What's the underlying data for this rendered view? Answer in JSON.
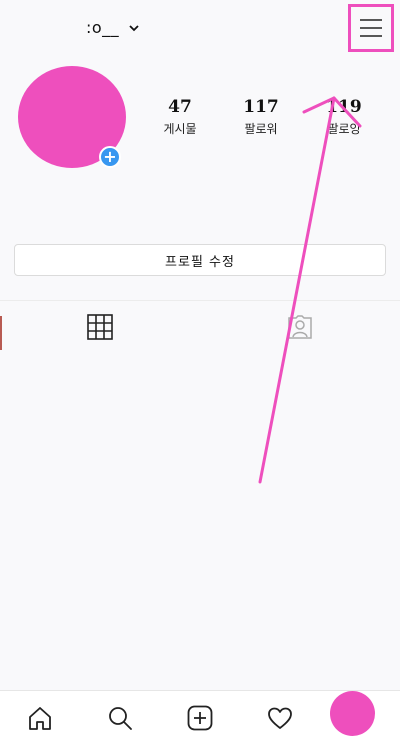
{
  "header": {
    "username": ":o__",
    "username_icon": "chevron-down-icon",
    "menu_icon": "hamburger-menu-icon"
  },
  "profile": {
    "avatar_color": "#ee4fbd",
    "add_badge_symbol": "+",
    "add_badge_color": "#3897f0",
    "stats": [
      {
        "value": "47",
        "label": "게시물"
      },
      {
        "value": "117",
        "label": "팔로워"
      },
      {
        "value": "119",
        "label": "팔로잉"
      }
    ],
    "edit_button_label": "프로필 수정"
  },
  "tabs": [
    {
      "icon": "grid-icon"
    },
    {
      "icon": "tagged-person-icon"
    }
  ],
  "annotation": {
    "color": "#ee4fbd",
    "type": "arrow-to-menu"
  },
  "bottom_nav": [
    {
      "icon": "home-icon"
    },
    {
      "icon": "search-icon"
    },
    {
      "icon": "new-post-icon"
    },
    {
      "icon": "heart-icon"
    },
    {
      "icon": "profile-avatar"
    }
  ]
}
